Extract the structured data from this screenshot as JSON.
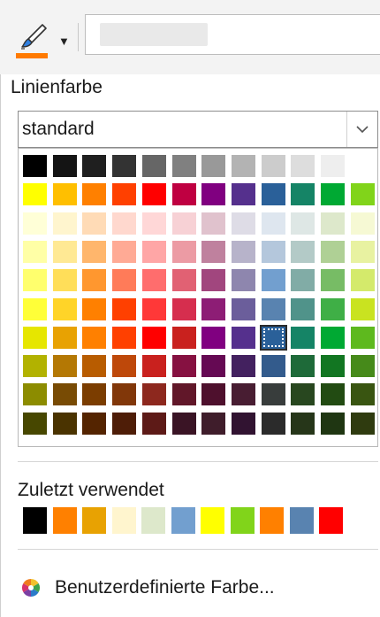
{
  "toolbar": {
    "line_color_button_icon": "brush-icon",
    "current_color": "#ff7a00",
    "dropdown_icon": "caret-down-icon"
  },
  "panel": {
    "heading": "Linienfarbe",
    "palette_select": {
      "value": "standard"
    },
    "palette": {
      "rows": [
        [
          "#000000",
          "#141414",
          "#1f1f1f",
          "#333333",
          "#666666",
          "#808080",
          "#999999",
          "#b3b3b3",
          "#cccccc",
          "#dddddd",
          "#eeeeee",
          "#ffffff"
        ],
        [
          "#ffff00",
          "#ffbf00",
          "#ff8000",
          "#ff4000",
          "#ff0000",
          "#bf0041",
          "#800080",
          "#55308d",
          "#2a6099",
          "#158466",
          "#00a933",
          "#81d41a"
        ],
        [
          "#ffffd7",
          "#fff5ce",
          "#ffdbb6",
          "#ffd8ce",
          "#ffd7d7",
          "#f7d1d5",
          "#e0c2cd",
          "#dedce6",
          "#dee6ef",
          "#dee7e5",
          "#dde8cb",
          "#f6f9d4"
        ],
        [
          "#ffffa6",
          "#ffe994",
          "#ffb66c",
          "#ffaa95",
          "#ffa6a6",
          "#ec9ba4",
          "#bf819e",
          "#b7b3ca",
          "#b4c7dc",
          "#b3cac7",
          "#afd095",
          "#e8f2a1"
        ],
        [
          "#ffff6d",
          "#ffde59",
          "#ff972f",
          "#ff7b59",
          "#ff6d6d",
          "#e16173",
          "#a1467e",
          "#8e86ae",
          "#729fcf",
          "#81aca6",
          "#77bc65",
          "#d4ea6b"
        ],
        [
          "#ffff38",
          "#ffd428",
          "#ff8000",
          "#ff4000",
          "#ff3838",
          "#d62e4e",
          "#8d1d75",
          "#6b5e9b",
          "#5983b0",
          "#50938a",
          "#3faf46",
          "#c9e320"
        ],
        [
          "#e6e600",
          "#e8a202",
          "#ff8000",
          "#ff4000",
          "#ff0000",
          "#c9211e",
          "#800080",
          "#55308d",
          "#2a6099",
          "#158466",
          "#00a933",
          "#5eb91e"
        ],
        [
          "#b2b200",
          "#b47804",
          "#b85c00",
          "#be480a",
          "#c9211e",
          "#861141",
          "#650953",
          "#43215f",
          "#335b8c",
          "#1e6a39",
          "#127622",
          "#468a1a"
        ],
        [
          "#8c8c00",
          "#784b04",
          "#7b3d00",
          "#813709",
          "#8d281e",
          "#611729",
          "#4e102d",
          "#481d32",
          "#383d3c",
          "#28471f",
          "#224b12",
          "#395511"
        ],
        [
          "#474700",
          "#4a3300",
          "#542400",
          "#4e1d07",
          "#5d1a17",
          "#3a1425",
          "#3f1d2b",
          "#311331",
          "#2b2b2b",
          "#263619",
          "#1f3612",
          "#2f3b0f"
        ]
      ],
      "selected": {
        "row": 6,
        "col": 8
      }
    },
    "recent": {
      "title": "Zuletzt verwendet",
      "colors": [
        "#000000",
        "#ff8000",
        "#e8a202",
        "#fff5ce",
        "#dde8cb",
        "#729fcf",
        "#ffff00",
        "#81d41a",
        "#ff8000",
        "#5983b0",
        "#ff0000"
      ]
    },
    "custom": {
      "icon": "color-wheel-icon",
      "label": "Benutzerdefinierte Farbe..."
    }
  }
}
